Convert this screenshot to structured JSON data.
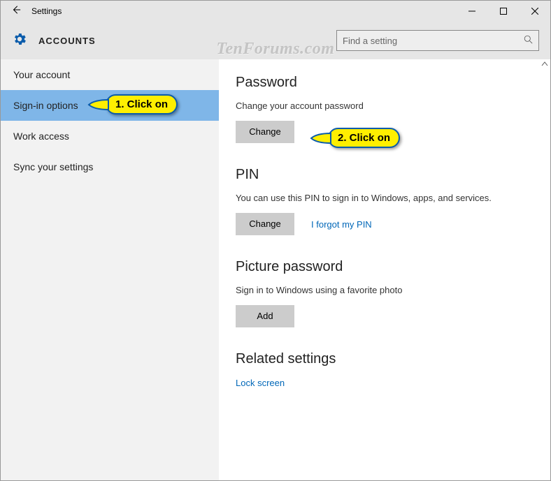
{
  "titlebar": {
    "title": "Settings"
  },
  "header": {
    "pagetitle": "ACCOUNTS",
    "search_placeholder": "Find a setting"
  },
  "sidebar": {
    "items": [
      {
        "label": "Your account"
      },
      {
        "label": "Sign-in options"
      },
      {
        "label": "Work access"
      },
      {
        "label": "Sync your settings"
      }
    ]
  },
  "main": {
    "password": {
      "heading": "Password",
      "desc": "Change your account password",
      "button": "Change"
    },
    "pin": {
      "heading": "PIN",
      "desc": "You can use this PIN to sign in to Windows, apps, and services.",
      "button": "Change",
      "forgot": "I forgot my PIN"
    },
    "picture": {
      "heading": "Picture password",
      "desc": "Sign in to Windows using a favorite photo",
      "button": "Add"
    },
    "related": {
      "heading": "Related settings",
      "link": "Lock screen"
    }
  },
  "callouts": {
    "c1": "1. Click on",
    "c2": "2. Click on"
  },
  "watermark": "TenForums.com"
}
